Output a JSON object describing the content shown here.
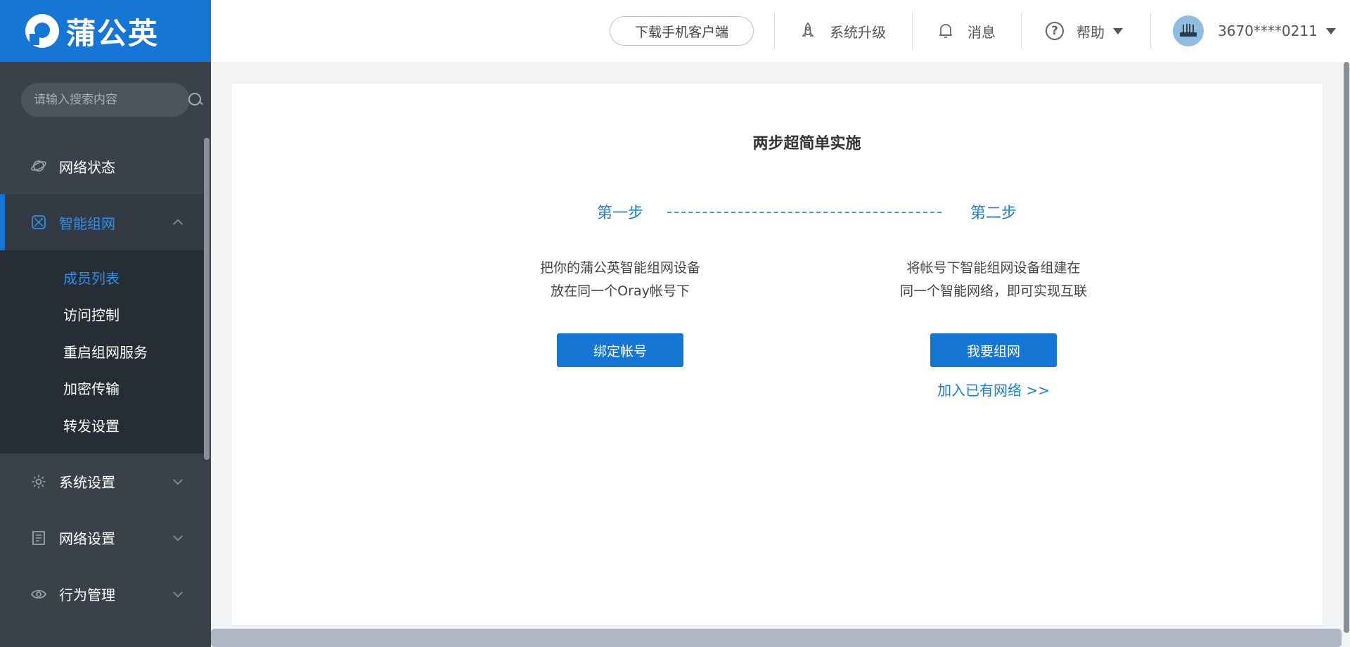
{
  "brand": {
    "name": "蒲公英"
  },
  "search": {
    "placeholder": "请输入搜索内容"
  },
  "sidebar": {
    "items": [
      {
        "label": "网络状态",
        "icon": "planet-icon"
      },
      {
        "label": "智能组网",
        "icon": "network-icon",
        "expanded": true
      },
      {
        "label": "系统设置",
        "icon": "gear-icon"
      },
      {
        "label": "网络设置",
        "icon": "document-icon"
      },
      {
        "label": "行为管理",
        "icon": "eye-icon"
      }
    ],
    "subitems": [
      {
        "label": "成员列表",
        "active": true
      },
      {
        "label": "访问控制"
      },
      {
        "label": "重启组网服务"
      },
      {
        "label": "加密传输"
      },
      {
        "label": "转发设置"
      }
    ]
  },
  "header": {
    "download_label": "下载手机客户端",
    "upgrade_label": "系统升级",
    "messages_label": "消息",
    "help_label": "帮助",
    "account": "3670****0211"
  },
  "main": {
    "title": "两步超简单实施",
    "step1": {
      "label": "第一步",
      "desc_line1": "把你的蒲公英智能组网设备",
      "desc_line2": "放在同一个Oray帐号下",
      "button": "绑定帐号"
    },
    "step2": {
      "label": "第二步",
      "desc_line1": "将帐号下智能组网设备组建在",
      "desc_line2": "同一个智能网络，即可实现互联",
      "button": "我要组网",
      "link": "加入已有网络 >>"
    }
  },
  "colors": {
    "accent": "#1576d6",
    "sidebar": "#3a414b",
    "submenu": "#272d35",
    "link": "#1c7ed6"
  }
}
